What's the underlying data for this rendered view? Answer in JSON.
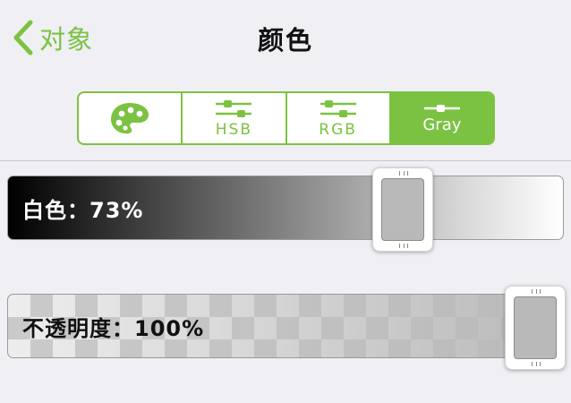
{
  "navbar": {
    "back_label": "对象",
    "title": "颜色"
  },
  "segments": [
    {
      "label": "",
      "icon": "palette-icon"
    },
    {
      "label": "HSB",
      "icon": "sliders-icon"
    },
    {
      "label": "RGB",
      "icon": "sliders-icon"
    },
    {
      "label": "Gray",
      "icon": "slider-icon"
    }
  ],
  "selected_segment": "Gray",
  "sliders": {
    "white": {
      "label": "白色：73%",
      "value_percent": 73
    },
    "opacity": {
      "label": "不透明度：100%",
      "value_percent": 100
    }
  },
  "colors": {
    "accent": "#7cc242",
    "background": "#efeff4"
  }
}
